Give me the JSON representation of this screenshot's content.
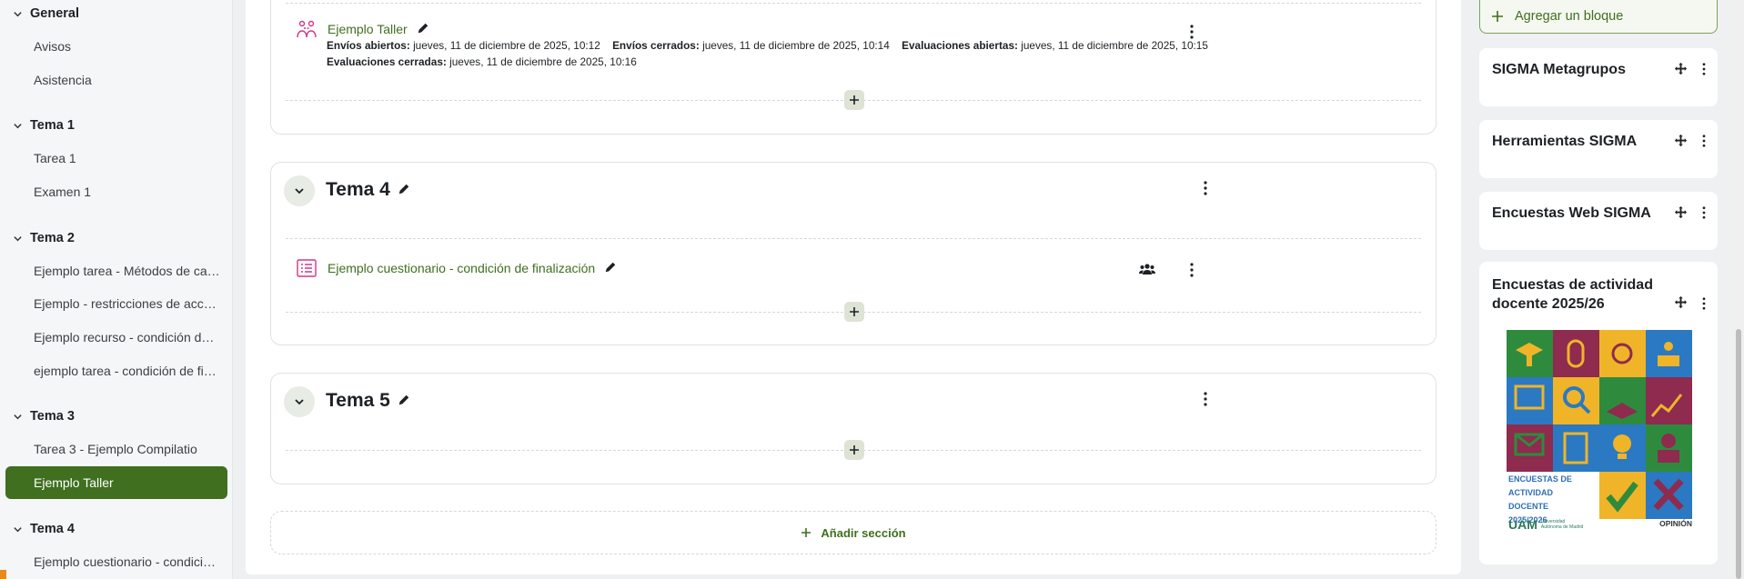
{
  "drawer": {
    "groups": [
      {
        "label": "General",
        "items": [
          "Avisos",
          "Asistencia"
        ]
      },
      {
        "label": "Tema 1",
        "items": [
          "Tarea 1",
          "Examen 1"
        ]
      },
      {
        "label": "Tema 2",
        "items": [
          "Ejemplo tarea - Métodos de calificación",
          "Ejemplo - restricciones de acceso",
          "Ejemplo recurso - condición de finalización",
          "ejemplo tarea - condición de finalización"
        ]
      },
      {
        "label": "Tema 3",
        "items": [
          "Tarea 3 - Ejemplo Compilatio",
          "Ejemplo Taller"
        ]
      },
      {
        "label": "Tema 4",
        "items": [
          "Ejemplo cuestionario - condición de finalización"
        ]
      }
    ]
  },
  "sections": {
    "tema3": {
      "activity": {
        "name": "Ejemplo Taller",
        "dates": {
          "l1": "Envíos abiertos:",
          "v1": "jueves, 11 de diciembre de 2025, 10:12",
          "l2": "Envíos cerrados:",
          "v2": "jueves, 11 de diciembre de 2025, 10:14",
          "l3": "Evaluaciones abiertas:",
          "v3": "jueves, 11 de diciembre de 2025, 10:15",
          "l4": "Evaluaciones cerradas:",
          "v4": "jueves, 11 de diciembre de 2025, 10:16"
        }
      }
    },
    "tema4": {
      "title": "Tema 4",
      "activity": {
        "name": "Ejemplo cuestionario - condición de finalización"
      }
    },
    "tema5": {
      "title": "Tema 5"
    }
  },
  "add_section_label": "Añadir sección",
  "blocks": {
    "add_block_label": "Agregar un bloque",
    "items": [
      "SIGMA Metagrupos",
      "Herramientas SIGMA",
      "Encuestas Web SIGMA",
      "Encuestas de actividad docente 2025/26"
    ],
    "poster": {
      "caption_l1": "ENCUESTAS DE",
      "caption_l2": "ACTIVIDAD DOCENTE",
      "caption_l3": "2025/2026",
      "uam": "UAM",
      "uam_sub": "Universidad Autónoma de Madrid",
      "opinion": "OPINIÓN"
    }
  },
  "colors": {
    "accent": "#3f6f1f",
    "activity_icon": "#d6338a"
  }
}
